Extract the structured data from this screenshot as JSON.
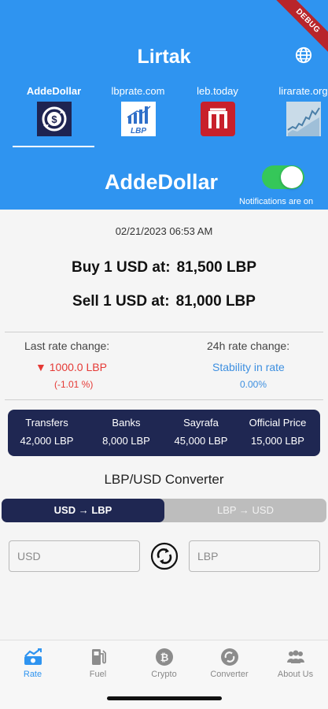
{
  "app": {
    "title": "Lirtak",
    "debug_banner": "DEBUG"
  },
  "tabs": [
    {
      "label": "AddeDollar",
      "active": true,
      "logo": "addedollar-logo"
    },
    {
      "label": "lbprate.com",
      "active": false,
      "logo": "lbprate-logo",
      "logo_text": "LBP"
    },
    {
      "label": "leb.today",
      "active": false,
      "logo": "lebtoday-logo"
    },
    {
      "label": "lirarate.org",
      "active": false,
      "logo": "lirarate-logo"
    }
  ],
  "source": {
    "title": "AddeDollar",
    "notifications_label": "Notifications are on",
    "notifications_on": true
  },
  "rate": {
    "timestamp": "02/21/2023 06:53 AM",
    "buy_label": "Buy 1 USD at:",
    "buy_value": "81,500 LBP",
    "sell_label": "Sell 1 USD at:",
    "sell_value": "81,000 LBP"
  },
  "changes": {
    "last_label": "Last rate change:",
    "last_value": "▼ 1000.0 LBP",
    "last_pct": "(-1.01 %)",
    "h24_label": "24h rate change:",
    "h24_value": "Stability in rate",
    "h24_pct": "0.00%"
  },
  "prices": [
    {
      "name": "Transfers",
      "value": "42,000 LBP"
    },
    {
      "name": "Banks",
      "value": "8,000 LBP"
    },
    {
      "name": "Sayrafa",
      "value": "45,000 LBP"
    },
    {
      "name": "Official Price",
      "value": "15,000 LBP"
    }
  ],
  "converter": {
    "title": "LBP/USD Converter",
    "mode_usd_lbp": "USD → LBP",
    "mode_lbp_usd": "LBP → USD",
    "active_mode": "USD → LBP",
    "usd_placeholder": "USD",
    "lbp_placeholder": "LBP"
  },
  "nav": [
    {
      "label": "Rate",
      "icon": "rate-chart-icon",
      "active": true
    },
    {
      "label": "Fuel",
      "icon": "fuel-pump-icon",
      "active": false
    },
    {
      "label": "Crypto",
      "icon": "bitcoin-icon",
      "active": false
    },
    {
      "label": "Converter",
      "icon": "converter-icon",
      "active": false
    },
    {
      "label": "About Us",
      "icon": "people-icon",
      "active": false
    }
  ],
  "colors": {
    "header_blue": "#2f94f0",
    "navy": "#1f2752",
    "decrease_red": "#e53935",
    "info_blue": "#3d8fe0",
    "toggle_green": "#35c759"
  }
}
